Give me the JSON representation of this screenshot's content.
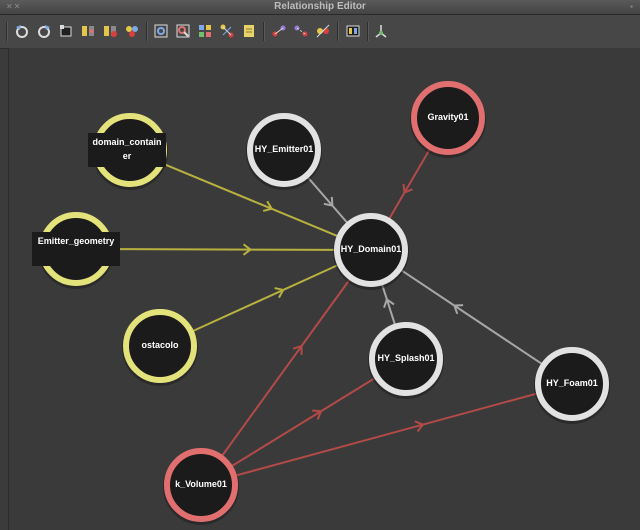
{
  "window": {
    "title": "Relationship Editor"
  },
  "toolbar": {
    "groups": [
      [
        "undo-icon",
        "redo-icon",
        "frame-icon",
        "node-select-icon",
        "node-remove-icon",
        "node-add-icon"
      ],
      [
        "zoom-fit-icon",
        "zoom-select-icon",
        "graph-layout-icon",
        "graph-connect-icon",
        "note-icon"
      ],
      [
        "link-icon",
        "unlink-icon",
        "relink-icon"
      ],
      [
        "palette-icon"
      ],
      [
        "pivot-icon"
      ]
    ]
  },
  "graph": {
    "colors": {
      "yellow": "#e4e27a",
      "white": "#e2e2e2",
      "red": "#e26f6f",
      "node_fill": "#1b1b1b",
      "edge_yellow": "#b8b13f",
      "edge_white": "#a7a7a7",
      "edge_red": "#b24a48"
    },
    "nodes": [
      {
        "id": "domain_container",
        "label": "domain_container",
        "label_style": "box",
        "color": "yellow"
      },
      {
        "id": "emitter_geometry",
        "label": "Emitter_geometry",
        "label_style": "box",
        "color": "yellow"
      },
      {
        "id": "ostacolo",
        "label": "ostacolo",
        "label_style": "plain",
        "color": "yellow"
      },
      {
        "id": "hy_emitter01",
        "label": "HY_Emitter01",
        "label_style": "plain",
        "color": "white"
      },
      {
        "id": "gravity01",
        "label": "Gravity01",
        "label_style": "plain",
        "color": "red"
      },
      {
        "id": "hy_domain01",
        "label": "HY_Domain01",
        "label_style": "plain",
        "color": "white"
      },
      {
        "id": "hy_splash01",
        "label": "HY_Splash01",
        "label_style": "plain",
        "color": "white"
      },
      {
        "id": "hy_foam01",
        "label": "HY_Foam01",
        "label_style": "plain",
        "color": "white"
      },
      {
        "id": "k_volume01",
        "label": "k_Volume01",
        "label_style": "plain",
        "color": "red"
      }
    ],
    "edges": [
      {
        "from": "domain_container",
        "to": "hy_domain01",
        "color": "edge_yellow"
      },
      {
        "from": "emitter_geometry",
        "to": "hy_domain01",
        "color": "edge_yellow"
      },
      {
        "from": "ostacolo",
        "to": "hy_domain01",
        "color": "edge_yellow"
      },
      {
        "from": "hy_emitter01",
        "to": "hy_domain01",
        "color": "edge_white"
      },
      {
        "from": "gravity01",
        "to": "hy_domain01",
        "color": "edge_red"
      },
      {
        "from": "hy_splash01",
        "to": "hy_domain01",
        "color": "edge_white"
      },
      {
        "from": "hy_foam01",
        "to": "hy_domain01",
        "color": "edge_white"
      },
      {
        "from": "k_volume01",
        "to": "hy_domain01",
        "color": "edge_red"
      },
      {
        "from": "k_volume01",
        "to": "hy_splash01",
        "color": "edge_red"
      },
      {
        "from": "k_volume01",
        "to": "hy_foam01",
        "color": "edge_red"
      }
    ]
  }
}
